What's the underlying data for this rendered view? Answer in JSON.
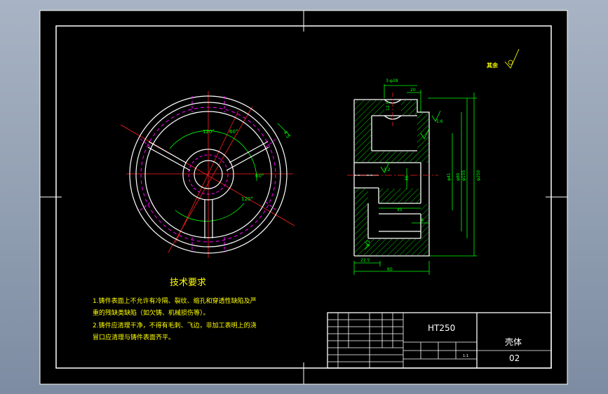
{
  "tech": {
    "title": "技术要求",
    "line1": "1.铸件表面上不允许有冷隔、裂纹、缩孔和穿透性缺陷及严",
    "line2": "重的残缺类缺陷（如欠铸、机械损伤等）。",
    "line3": "2.铸件应清理干净，不得有毛刺、飞边，非加工表明上的浇",
    "line4": "冒口应清理与铸件表面齐平。"
  },
  "surface_note": "其余",
  "title_block": {
    "material": "HT250",
    "part_name": "壳体",
    "drawing_no": "02",
    "scale": "1:1"
  },
  "dims": {
    "top_holes": "3-φ28",
    "top_width": "20",
    "right_rough": "1.6",
    "outer_dia": "φ250",
    "height_dims": [
      "φ41",
      "φ80",
      "φ155"
    ],
    "mid_dim": "36",
    "bottom_dim": "45",
    "small_dim": "8",
    "left_bottom": "22.5",
    "total_width": "60",
    "rough_top": "12.5",
    "rough_left": "3.2",
    "rough_bottom": "3.2",
    "angles": [
      "120°",
      "60°",
      "60°",
      "120°"
    ],
    "chamfer": "4.5"
  },
  "colors": {
    "outline": "#ffffff",
    "dimension": "#00ff00",
    "center": "#ff2020",
    "hidden": "#ff00ff",
    "hatch": "#00ff00",
    "text": "#ffff00",
    "border": "#ffffff"
  }
}
